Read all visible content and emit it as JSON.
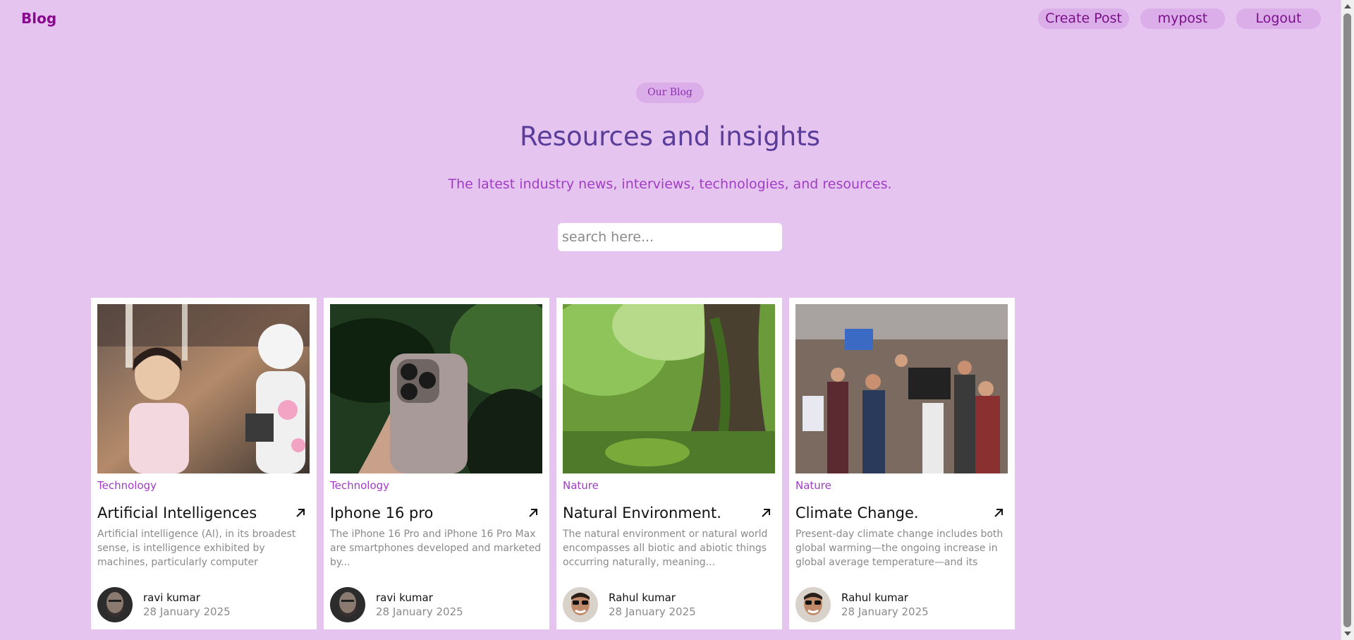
{
  "nav": {
    "brand": "Blog",
    "buttons": [
      {
        "label": "Create Post"
      },
      {
        "label": "mypost"
      },
      {
        "label": "Logout"
      }
    ]
  },
  "hero": {
    "badge": "Our Blog",
    "title": "Resources and insights",
    "subtitle": "The latest industry news, interviews, technologies, and resources."
  },
  "search": {
    "placeholder": "search here..."
  },
  "posts": [
    {
      "category": "Technology",
      "title": "Artificial Intelligences",
      "description": "Artificial intelligence (AI), in its broadest sense, is intelligence exhibited by machines, particularly computer systems....",
      "author": "ravi kumar",
      "date": "28 January 2025",
      "image_icon": "child-and-robot-photo",
      "avatar_icon": "bearded-man-avatar"
    },
    {
      "category": "Technology",
      "title": "Iphone 16 pro",
      "description": "The iPhone 16 Pro and iPhone 16 Pro Max are smartphones developed and marketed by...",
      "author": "ravi kumar",
      "date": "28 January 2025",
      "image_icon": "iphone-photo",
      "avatar_icon": "bearded-man-avatar"
    },
    {
      "category": "Nature",
      "title": "Natural Environment.",
      "description": "The natural environment or natural world encompasses all biotic and abiotic things occurring naturally, meaning...",
      "author": "Rahul kumar",
      "date": "28 January 2025",
      "image_icon": "forest-tree-photo",
      "avatar_icon": "sunglasses-man-avatar"
    },
    {
      "category": "Nature",
      "title": "Climate Change.",
      "description": "Present-day climate change includes both global warming—the ongoing increase in global average temperature—and its wider...",
      "author": "Rahul kumar",
      "date": "28 January 2025",
      "image_icon": "climate-protest-photo",
      "avatar_icon": "sunglasses-man-avatar"
    }
  ],
  "colors": {
    "background": "#e5c4ef",
    "brand": "#8a078f",
    "accent": "#a13cc5",
    "title": "#5a3d9a"
  }
}
